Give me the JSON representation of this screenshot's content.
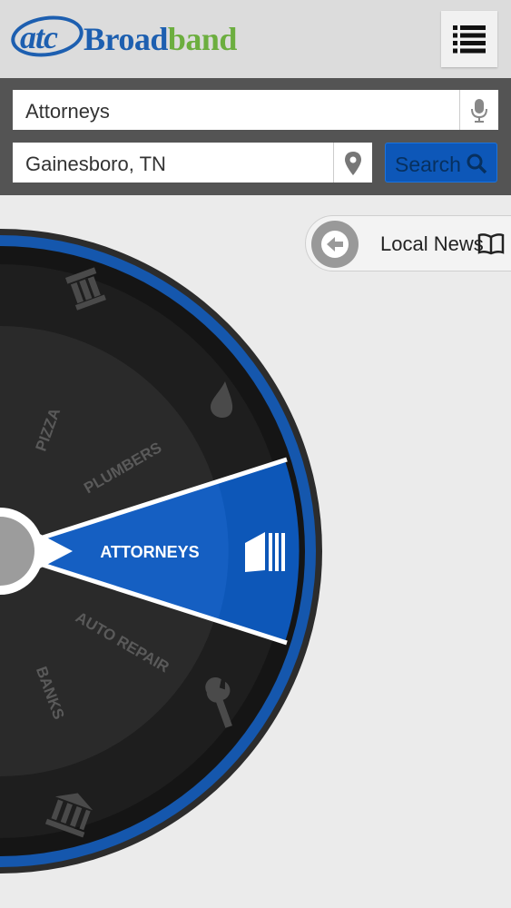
{
  "brand": {
    "atc": "atc",
    "broad": "Broad",
    "band": "band",
    "oval_color": "#1d5fb0",
    "green": "#6cae3f"
  },
  "header": {
    "menu_icon": "list-icon"
  },
  "search": {
    "keyword_value": "Attorneys",
    "location_value": "Gainesboro, TN",
    "button_label": "Search",
    "mic_icon": "microphone-icon",
    "location_icon": "map-pin-icon",
    "search_icon": "magnifier-icon"
  },
  "news_tab": {
    "label": "Local News",
    "back_icon": "arrow-left-icon",
    "book_icon": "book-icon"
  },
  "wheel": {
    "selected": "ATTORNEYS",
    "categories": [
      "PIZZA",
      "PLUMBERS",
      "ATTORNEYS",
      "AUTO REPAIR",
      "BANKS"
    ],
    "icons": [
      "columns-icon",
      "drop-icon",
      "books-icon",
      "wrench-icon",
      "bank-icon"
    ],
    "accent": "#0d57b8"
  }
}
